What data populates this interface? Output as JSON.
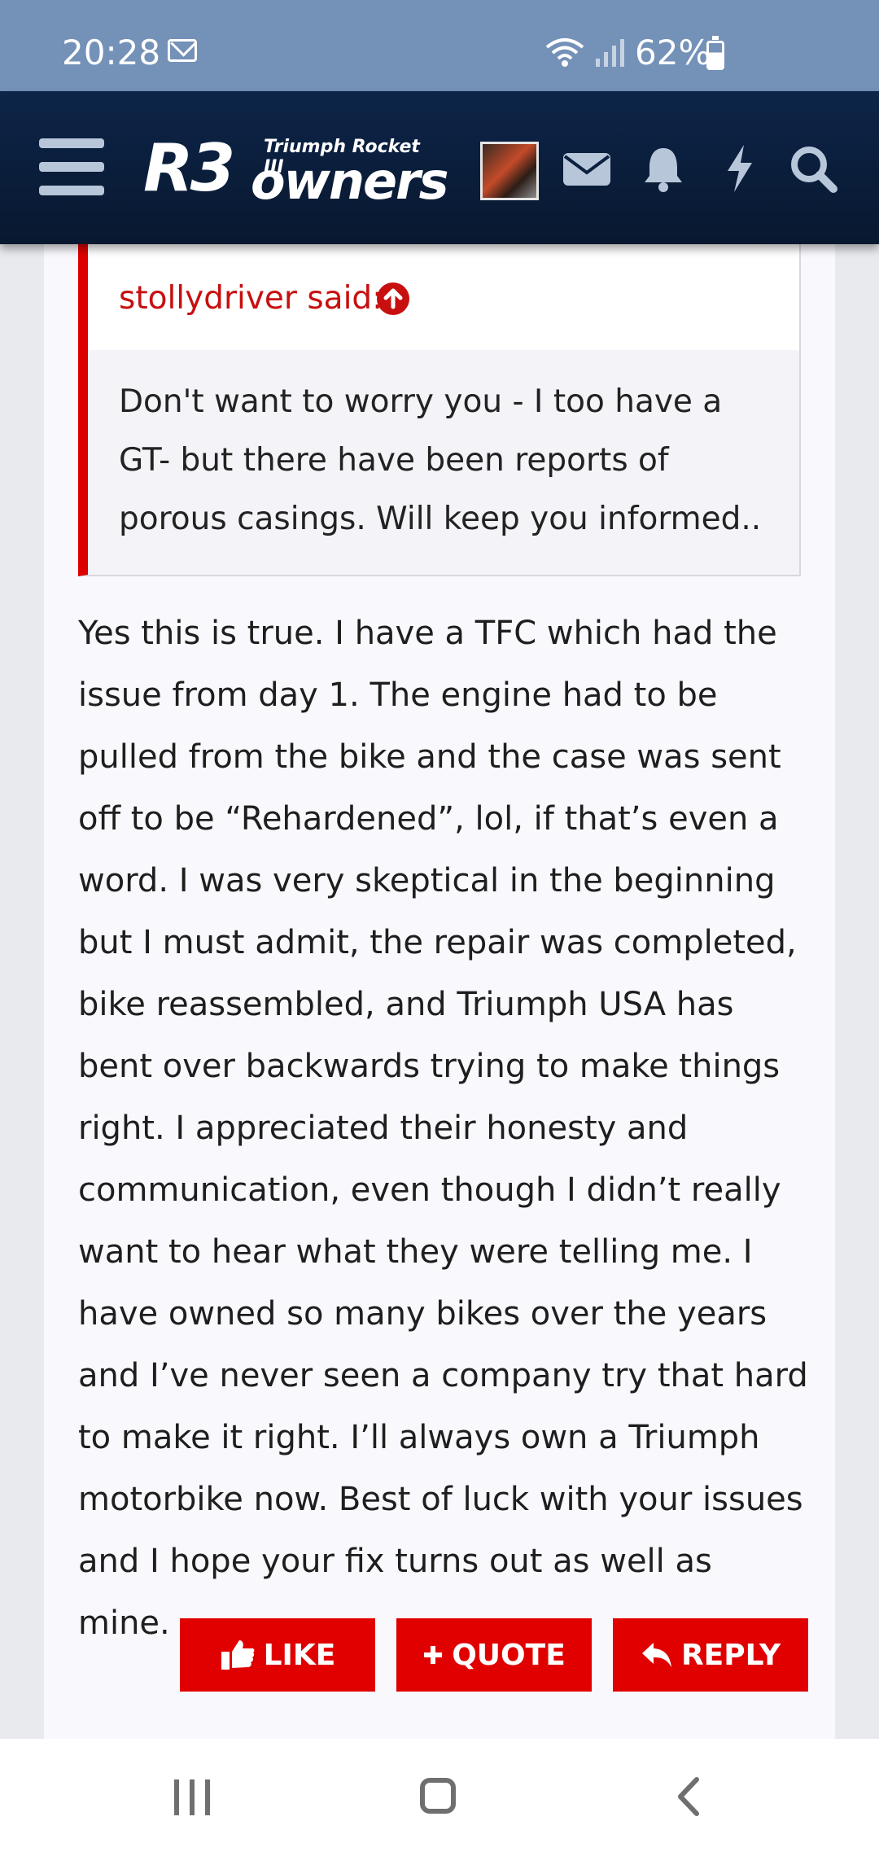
{
  "status_bar": {
    "time": "20:28",
    "battery": "62%",
    "icons": [
      "mail-icon",
      "wifi-icon",
      "signal-icon",
      "battery-icon"
    ]
  },
  "header": {
    "logo_main": "R3",
    "logo_secondary": "owners",
    "logo_tagline": "Triumph Rocket III",
    "icons": [
      "menu-icon",
      "avatar",
      "envelope-icon",
      "bell-icon",
      "bolt-icon",
      "search-icon"
    ],
    "colors": {
      "background": "#0d2549",
      "icon": "#b8c6da"
    }
  },
  "quote": {
    "author": "stollydriver said:",
    "text": "Don't want to worry you - I too have a GT- but there have been reports of porous casings. Will keep you informed..",
    "accent": "#dd0000"
  },
  "post": {
    "text": "Yes this is true. I have a TFC which had the issue from day 1. The engine had to be pulled from the bike and the case was sent off to be “Rehardened”, lol, if that’s even a word. I was very skeptical in the beginning but I must admit, the repair was completed, bike reassembled, and Triumph USA has bent over backwards trying to make things right. I appreciated their honesty and communication, even though I didn’t really want to hear what they were telling me. I have owned so many bikes over the years and I’ve never seen a company try that hard to make it right. I’ll always own a Triumph motorbike now. Best of luck with your issues and I hope your fix turns out as well as mine."
  },
  "actions": {
    "like_label": "LIKE",
    "quote_label": "QUOTE",
    "reply_label": "REPLY",
    "button_color": "#e00000"
  },
  "nav_bar": {
    "icons": [
      "recent-apps-icon",
      "home-icon",
      "back-icon"
    ]
  }
}
